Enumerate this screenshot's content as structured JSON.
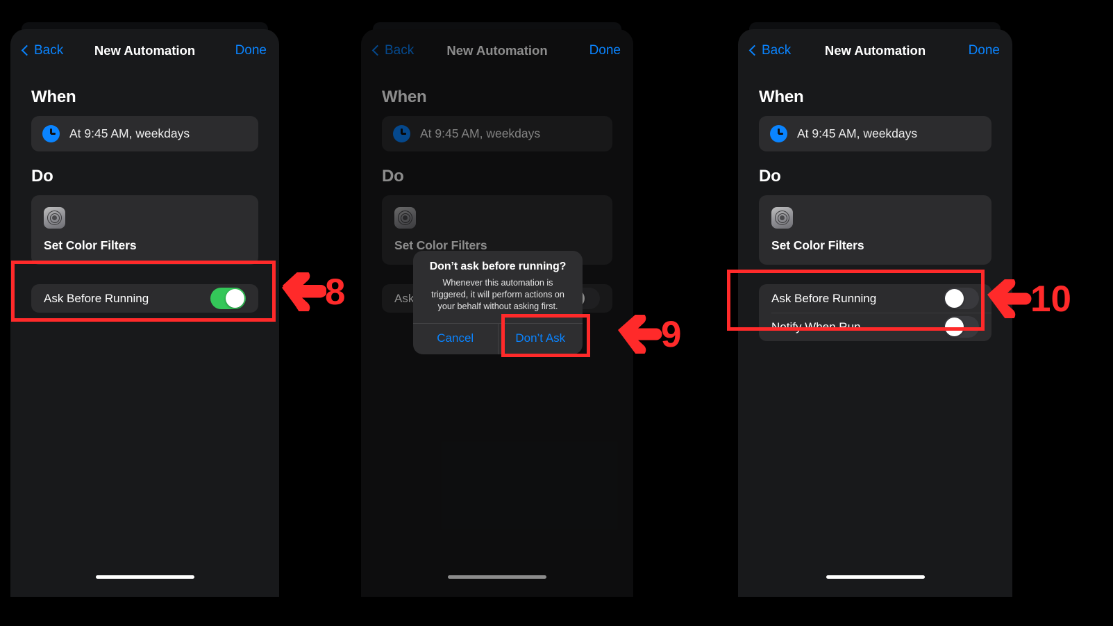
{
  "nav": {
    "back_label": "Back",
    "title": "New Automation",
    "done_label": "Done",
    "back_icon": "chevron-left-icon"
  },
  "sections": {
    "when_title": "When",
    "do_title": "Do"
  },
  "trigger": {
    "label": "At 9:45 AM, weekdays",
    "icon": "clock-icon",
    "icon_color": "#0A84FF"
  },
  "action": {
    "label": "Set Color Filters",
    "icon": "color-filters-app-icon"
  },
  "toggles": {
    "ask_before_running": "Ask Before Running",
    "notify_when_run": "Notify When Run"
  },
  "panel1": {
    "ask_before_running_state": "on",
    "ask_toggle_color": "#34C759"
  },
  "panel2": {
    "ask_before_running_state": "off",
    "dimmed": "true"
  },
  "panel3": {
    "ask_before_running_state": "off",
    "notify_when_run_state": "off",
    "toggle_off_color": "#39393D"
  },
  "alert": {
    "title": "Don’t ask before running?",
    "message": "Whenever this automation is triggered, it will perform actions on your behalf without asking first.",
    "cancel_label": "Cancel",
    "confirm_label": "Don’t Ask"
  },
  "annotations": {
    "accent_color": "#FF2A2A",
    "step8": "8",
    "step9": "9",
    "step10": "10",
    "arrow_icon": "arrow-left-icon"
  }
}
